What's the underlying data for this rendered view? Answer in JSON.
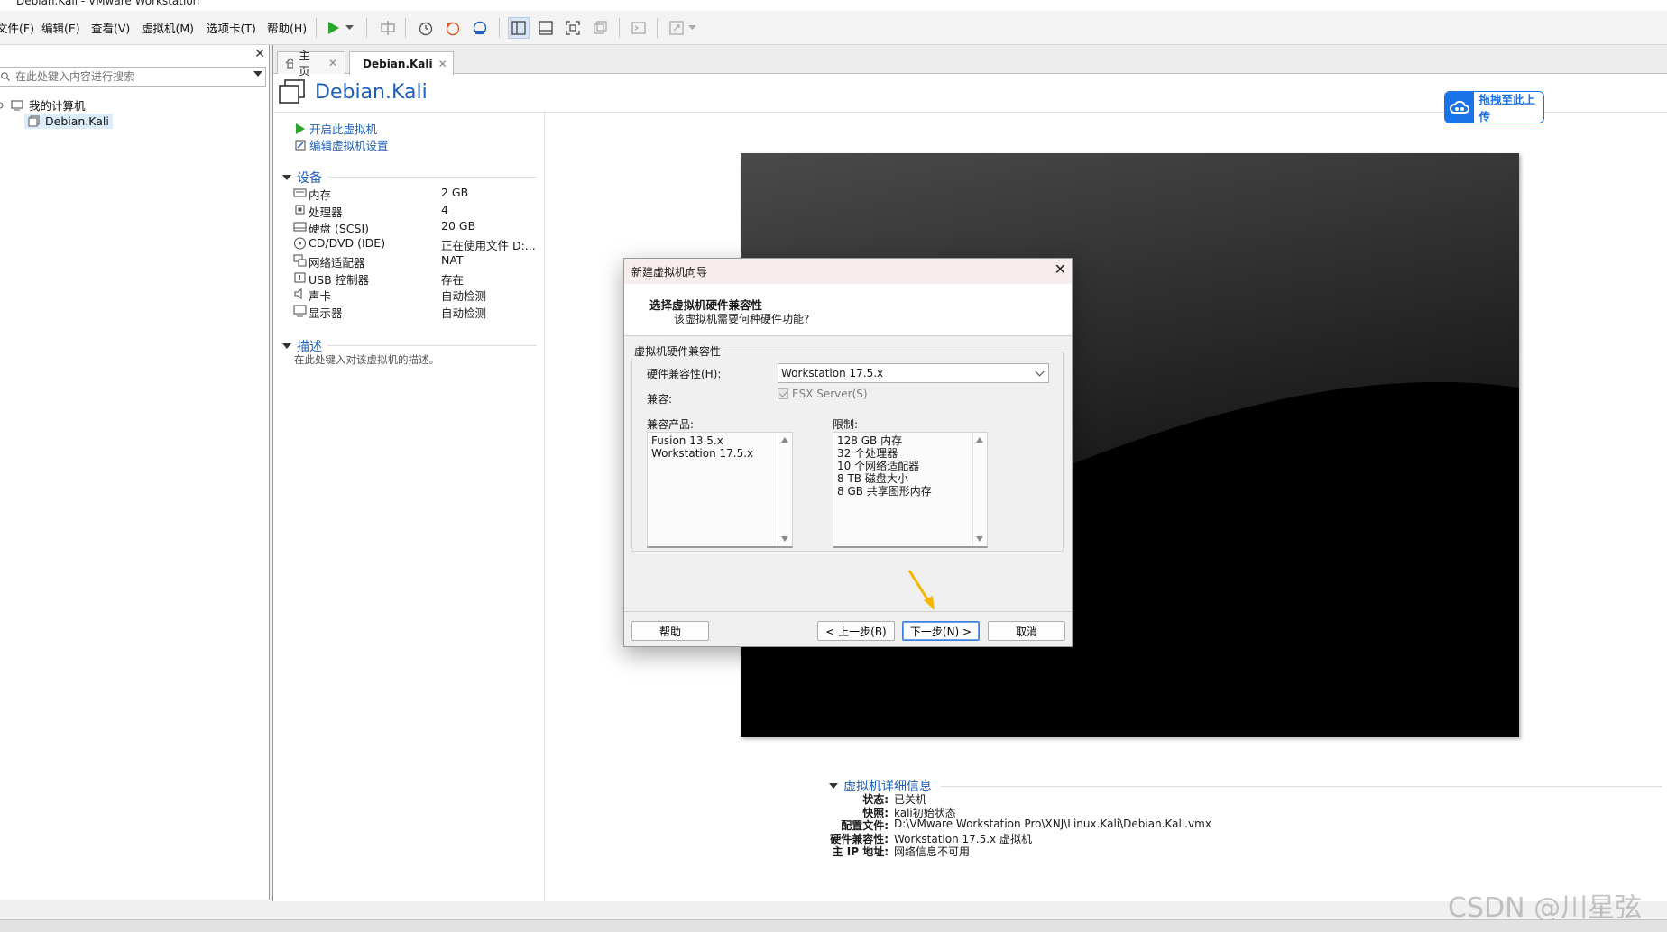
{
  "window": {
    "title": "Debian.Kali - VMware Workstation"
  },
  "menu": [
    "文件(F)",
    "编辑(E)",
    "查看(V)",
    "虚拟机(M)",
    "选项卡(T)",
    "帮助(H)"
  ],
  "library": {
    "search_placeholder": "在此处键入内容进行搜索",
    "tree_root": "我的计算机",
    "tree_vm": "Debian.Kali"
  },
  "tabs": [
    {
      "label": "主页",
      "icon": "home-icon"
    },
    {
      "label": "Debian.Kali",
      "icon": "vm-icon"
    }
  ],
  "vm": {
    "title": "Debian.Kali",
    "actions": {
      "power_on": "开启此虚拟机",
      "edit_settings": "编辑虚拟机设置"
    },
    "devices_header": "设备",
    "devices": [
      {
        "name": "内存",
        "value": "2 GB",
        "icon": "memory-icon"
      },
      {
        "name": "处理器",
        "value": "4",
        "icon": "cpu-icon"
      },
      {
        "name": "硬盘 (SCSI)",
        "value": "20 GB",
        "icon": "harddisk-icon"
      },
      {
        "name": "CD/DVD (IDE)",
        "value": "正在使用文件 D:...",
        "icon": "cd-icon"
      },
      {
        "name": "网络适配器",
        "value": "NAT",
        "icon": "network-icon"
      },
      {
        "name": "USB 控制器",
        "value": "存在",
        "icon": "usb-icon"
      },
      {
        "name": "声卡",
        "value": "自动检测",
        "icon": "sound-icon"
      },
      {
        "name": "显示器",
        "value": "自动检测",
        "icon": "display-icon"
      }
    ],
    "description_header": "描述",
    "description_placeholder": "在此处键入对该虚拟机的描述。",
    "details_header": "虚拟机详细信息",
    "details": [
      {
        "key": "状态:",
        "value": "已关机"
      },
      {
        "key": "快照:",
        "value": "kali初始状态"
      },
      {
        "key": "配置文件:",
        "value": "D:\\VMware Workstation Pro\\XNJ\\Linux.Kali\\Debian.Kali.vmx"
      },
      {
        "key": "硬件兼容性:",
        "value": "Workstation 17.5.x 虚拟机"
      },
      {
        "key": "主 IP 地址:",
        "value": "网络信息不可用"
      }
    ]
  },
  "upload_button": "拖拽至此上传",
  "dialog": {
    "title": "新建虚拟机向导",
    "heading": "选择虚拟机硬件兼容性",
    "subheading": "该虚拟机需要何种硬件功能?",
    "group_label": "虚拟机硬件兼容性",
    "hw_label": "硬件兼容性(H):",
    "hw_value": "Workstation 17.5.x",
    "compat_label": "兼容:",
    "esx_label": "ESX Server(S)",
    "esx_checked": true,
    "products_label": "兼容产品:",
    "products": [
      "Fusion 13.5.x",
      "Workstation 17.5.x"
    ],
    "limits_label": "限制:",
    "limits": [
      "128 GB 内存",
      "32 个处理器",
      "10 个网络适配器",
      "8 TB 磁盘大小",
      "8 GB 共享图形内存"
    ],
    "buttons": {
      "help": "帮助",
      "back": "< 上一步(B)",
      "next": "下一步(N) >",
      "cancel": "取消"
    }
  },
  "watermark": "CSDN @川星弦",
  "colors": {
    "accent": "#1d5fb8",
    "upload": "#1a73e8",
    "arrow": "#f5b800"
  }
}
